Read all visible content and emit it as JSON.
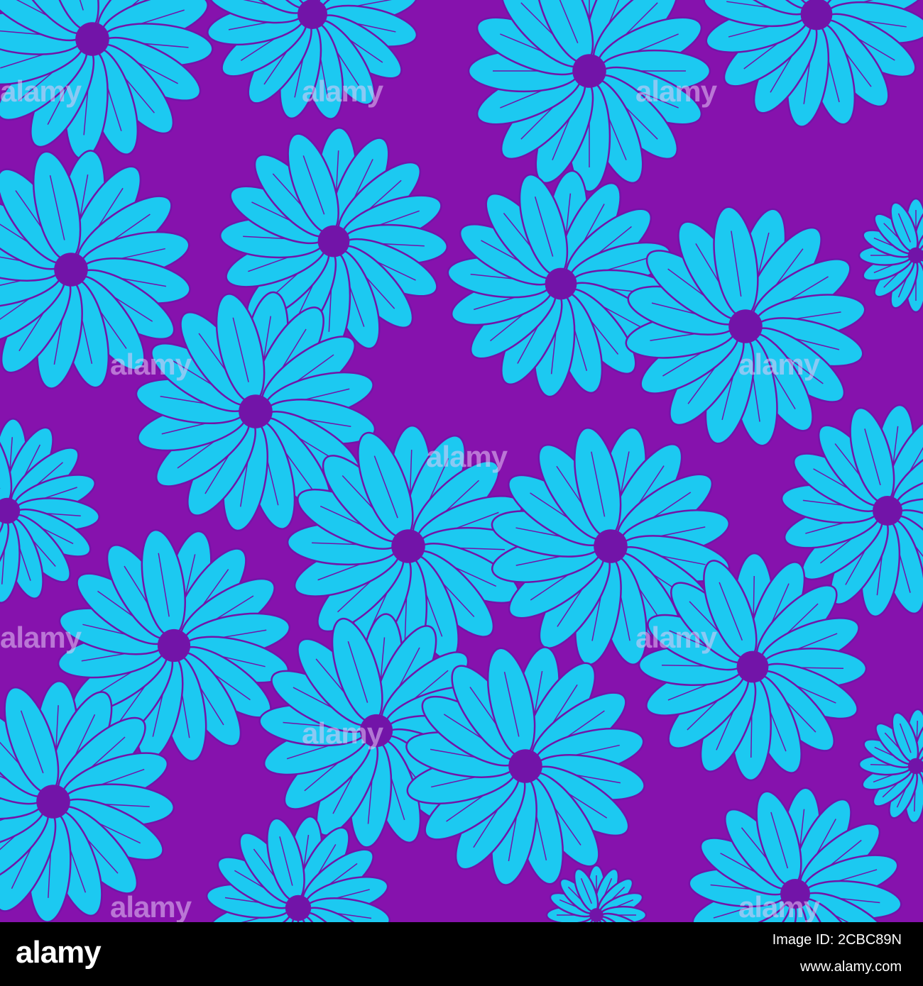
{
  "image": {
    "description_colors": {
      "background": "#8612ad",
      "petal": "#1cc9f1",
      "outline": "#7214a8"
    }
  },
  "watermark": {
    "text": "alamy"
  },
  "footer": {
    "logo": "alamy",
    "image_id_line": "Image ID: 2CBC89N",
    "url_line": "www.alamy.com"
  }
}
